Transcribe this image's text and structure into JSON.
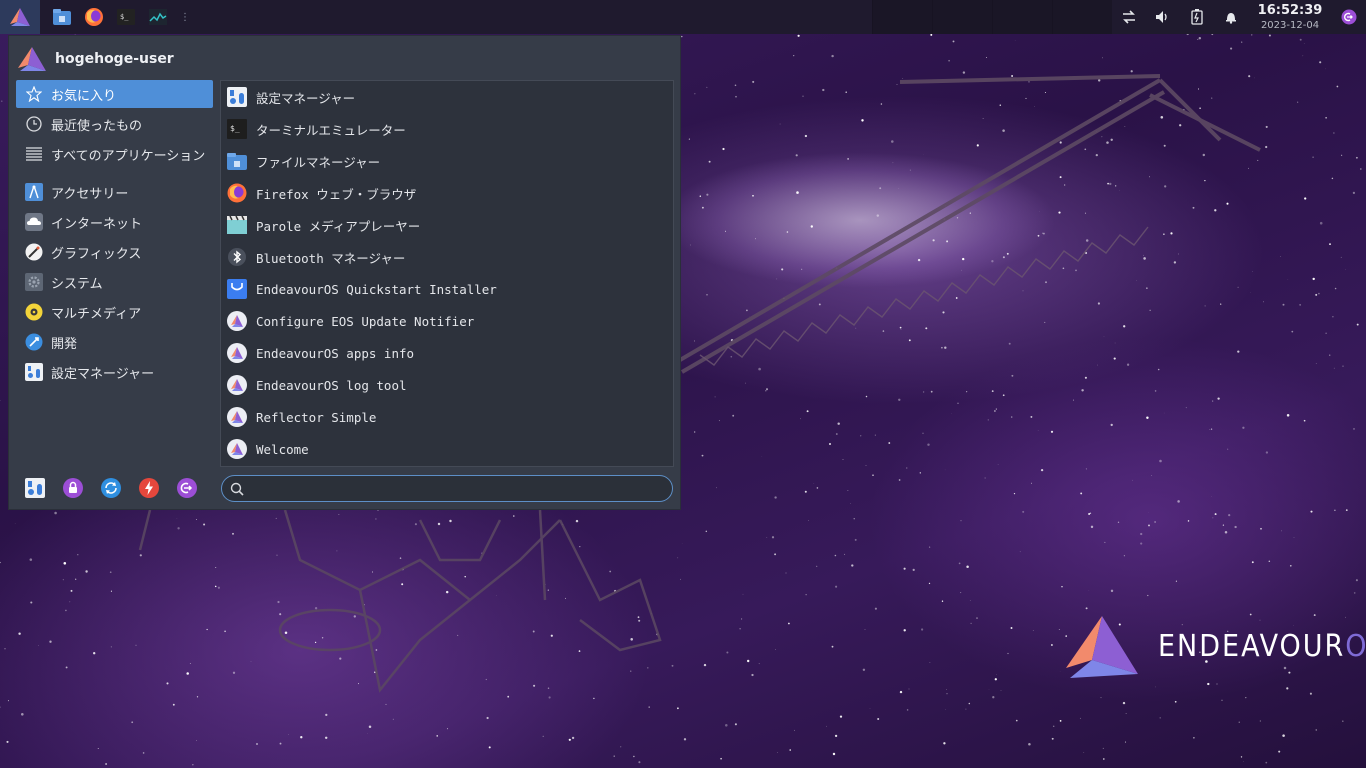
{
  "desktop": {
    "brand_logo_text": "ENDEAVOUROS"
  },
  "panel": {
    "launcher_icon": "endeavouros-logo-icon",
    "tasks": [
      {
        "name": "file-manager-icon"
      },
      {
        "name": "firefox-icon"
      },
      {
        "name": "terminal-icon"
      },
      {
        "name": "system-monitor-icon"
      }
    ],
    "tray": [
      {
        "name": "network-icon"
      },
      {
        "name": "volume-icon"
      },
      {
        "name": "battery-icon"
      },
      {
        "name": "notification-bell-icon"
      }
    ],
    "clock": {
      "time": "16:52:39",
      "date": "2023-12-04"
    },
    "logout_icon": "logout-icon"
  },
  "menu": {
    "username": "hogehoge-user",
    "categories_top": [
      {
        "label": "お気に入り",
        "icon": "star-icon",
        "active": true
      },
      {
        "label": "最近使ったもの",
        "icon": "clock-icon"
      },
      {
        "label": "すべてのアプリケーション",
        "icon": "list-icon"
      }
    ],
    "categories": [
      {
        "label": "アクセサリー",
        "icon": "accessories-icon"
      },
      {
        "label": "インターネット",
        "icon": "cloud-icon"
      },
      {
        "label": "グラフィックス",
        "icon": "graphics-icon"
      },
      {
        "label": "システム",
        "icon": "system-gear-icon"
      },
      {
        "label": "マルチメディア",
        "icon": "multimedia-icon"
      },
      {
        "label": "開発",
        "icon": "development-icon"
      },
      {
        "label": "設定マネージャー",
        "icon": "settings-icon"
      }
    ],
    "apps": [
      {
        "label": "設定マネージャー",
        "icon": "settings-manager-icon"
      },
      {
        "label": "ターミナルエミュレーター",
        "icon": "terminal-icon"
      },
      {
        "label": "ファイルマネージャー",
        "icon": "folder-icon"
      },
      {
        "label": "Firefox ウェブ・ブラウザ",
        "icon": "firefox-icon"
      },
      {
        "label": "Parole メディアプレーヤー",
        "icon": "parole-icon"
      },
      {
        "label": "Bluetooth マネージャー",
        "icon": "bluetooth-icon"
      },
      {
        "label": "EndeavourOS Quickstart Installer",
        "icon": "installer-icon"
      },
      {
        "label": "Configure EOS Update Notifier",
        "icon": "eos-icon"
      },
      {
        "label": "EndeavourOS apps info",
        "icon": "eos-icon"
      },
      {
        "label": "EndeavourOS log tool",
        "icon": "eos-icon"
      },
      {
        "label": "Reflector Simple",
        "icon": "eos-icon"
      },
      {
        "label": "Welcome",
        "icon": "eos-icon"
      }
    ],
    "actions": [
      {
        "name": "settings-action-icon"
      },
      {
        "name": "lock-icon"
      },
      {
        "name": "switch-user-icon"
      },
      {
        "name": "power-icon"
      },
      {
        "name": "logout-icon"
      }
    ],
    "search": {
      "placeholder": "",
      "value": ""
    }
  },
  "colors": {
    "accent": "#4f8fd8",
    "menu_bg": "#363c48",
    "panel_bg": "#1f1a2e",
    "eos_purple": "#7f6bd6"
  }
}
